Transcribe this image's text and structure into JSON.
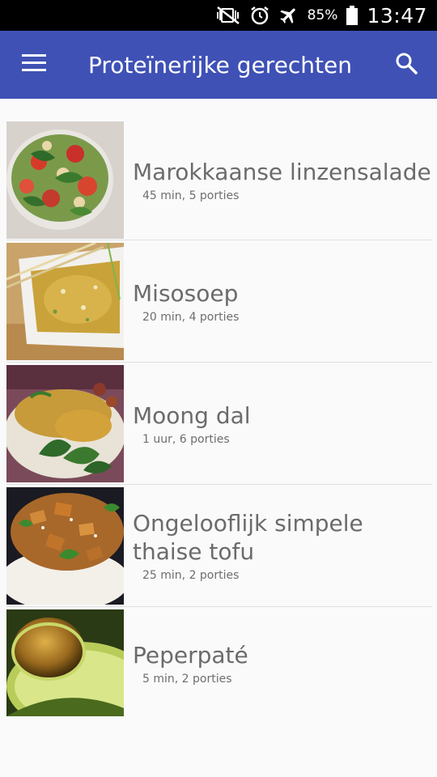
{
  "status_bar": {
    "battery_percent": "85%",
    "time": "13:47",
    "icons": [
      "mute-vibrate-icon",
      "alarm-icon",
      "airplane-mode-icon",
      "battery-icon"
    ]
  },
  "app_bar": {
    "title": "Proteïnerijke gerechten",
    "icons": [
      "menu-icon",
      "search-icon"
    ],
    "color": "#3f51b5"
  },
  "recipes": [
    {
      "title": "Marokkaanse linzensalade",
      "meta": "45 min, 5 porties",
      "image": "salad"
    },
    {
      "title": "Misosoep",
      "meta": "20 min, 4 porties",
      "image": "miso-soup"
    },
    {
      "title": "Moong dal",
      "meta": "1 uur, 6 porties",
      "image": "dal"
    },
    {
      "title": "Ongelooflijk simpele thaise tofu",
      "meta": "25 min, 2 porties",
      "image": "tofu-rice"
    },
    {
      "title": "Peperpaté",
      "meta": "5 min, 2 porties",
      "image": "avocado"
    }
  ]
}
